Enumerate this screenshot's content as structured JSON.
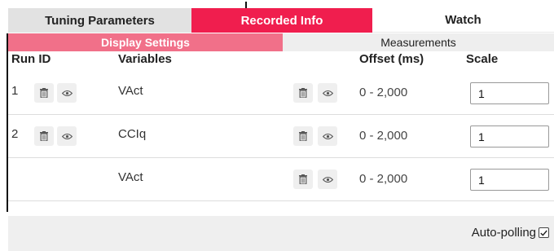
{
  "tabs": {
    "tuning": "Tuning Parameters",
    "recorded": "Recorded Info",
    "watch": "Watch"
  },
  "subtabs": {
    "display": "Display Settings",
    "measurements": "Measurements"
  },
  "headers": {
    "run_id": "Run ID",
    "variables": "Variables",
    "offset": "Offset (ms)",
    "scale": "Scale"
  },
  "rows": [
    {
      "run_id": "1",
      "variable": "VAct",
      "offset": "0 - 2,000",
      "scale": "1"
    },
    {
      "run_id": "2",
      "variable": "CCIq",
      "offset": "0 - 2,000",
      "scale": "1"
    },
    {
      "run_id": "",
      "variable": "VAct",
      "offset": "0 - 2,000",
      "scale": "1"
    }
  ],
  "footer": {
    "auto_polling_label": "Auto-polling",
    "auto_polling_checked": true
  },
  "icons": {
    "delete": "trash-icon",
    "view": "eye-icon"
  },
  "colors": {
    "active_tab": "#f01e4e",
    "active_subtab": "#f17089"
  }
}
